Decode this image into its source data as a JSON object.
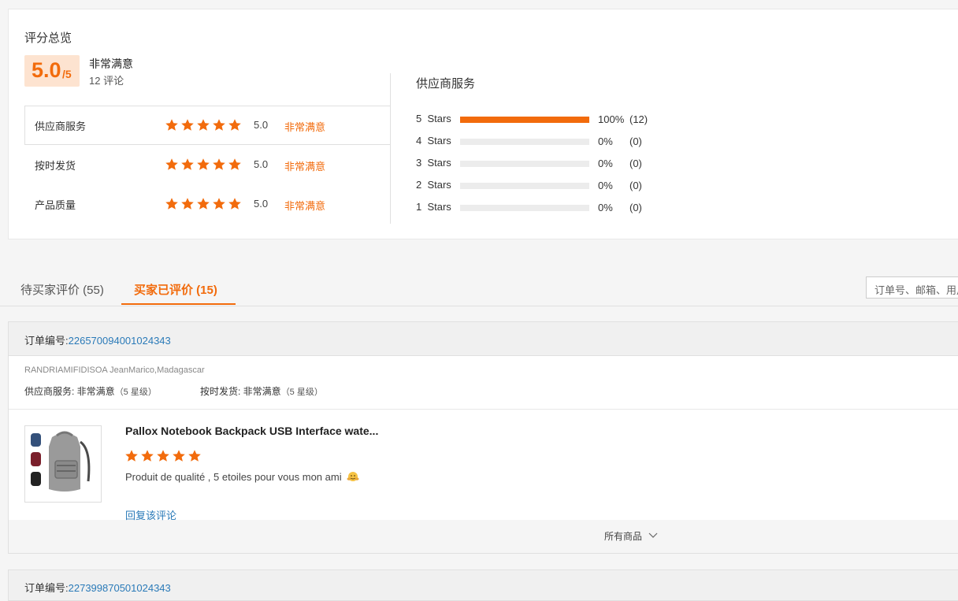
{
  "summary": {
    "title": "评分总览",
    "score": "5.0",
    "score_max": "/5",
    "satisfaction": "非常满意",
    "review_count": "12 评论",
    "ratings": [
      {
        "label": "供应商服务",
        "score": "5.0",
        "text": "非常满意",
        "stars": 5
      },
      {
        "label": "按时发货",
        "score": "5.0",
        "text": "非常满意",
        "stars": 5
      },
      {
        "label": "产品质量",
        "score": "5.0",
        "text": "非常满意",
        "stars": 5
      }
    ],
    "distribution_title": "供应商服务",
    "distribution": [
      {
        "label": "5  Stars",
        "percent": "100%",
        "count": "(12)",
        "fraction": 1.0
      },
      {
        "label": "4  Stars",
        "percent": "0%",
        "count": "(0)",
        "fraction": 0
      },
      {
        "label": "3  Stars",
        "percent": "0%",
        "count": "(0)",
        "fraction": 0
      },
      {
        "label": "2  Stars",
        "percent": "0%",
        "count": "(0)",
        "fraction": 0
      },
      {
        "label": "1  Stars",
        "percent": "0%",
        "count": "(0)",
        "fraction": 0
      }
    ]
  },
  "tabs": [
    {
      "label": "待买家评价 (55)",
      "active": false
    },
    {
      "label": "买家已评价 (15)",
      "active": true
    }
  ],
  "search": {
    "placeholder": "订单号、邮箱、用户名"
  },
  "orders": [
    {
      "order_label": "订单编号:",
      "order_number": "226570094001024343",
      "buyer": "RANDRIAMIFIDISOA JeanMarico,Madagascar",
      "service_label": "供应商服务: ",
      "service_value": "非常满意",
      "service_level": "（5 星级）",
      "shipping_label": "按时发货: ",
      "shipping_value": "非常满意",
      "shipping_level": "（5 星级）",
      "product_title": "Pallox Notebook Backpack USB Interface wate...",
      "product_stars": 5,
      "comment": "Produit de qualité , 5 etoiles pour vous mon ami",
      "reply_link": "回复该评论",
      "all_products": "所有商品"
    },
    {
      "order_label": "订单编号:",
      "order_number": "227399870501024343"
    }
  ],
  "colors": {
    "accent": "#f26b0c",
    "link": "#2a7ab8",
    "star": "#f26b0c"
  }
}
